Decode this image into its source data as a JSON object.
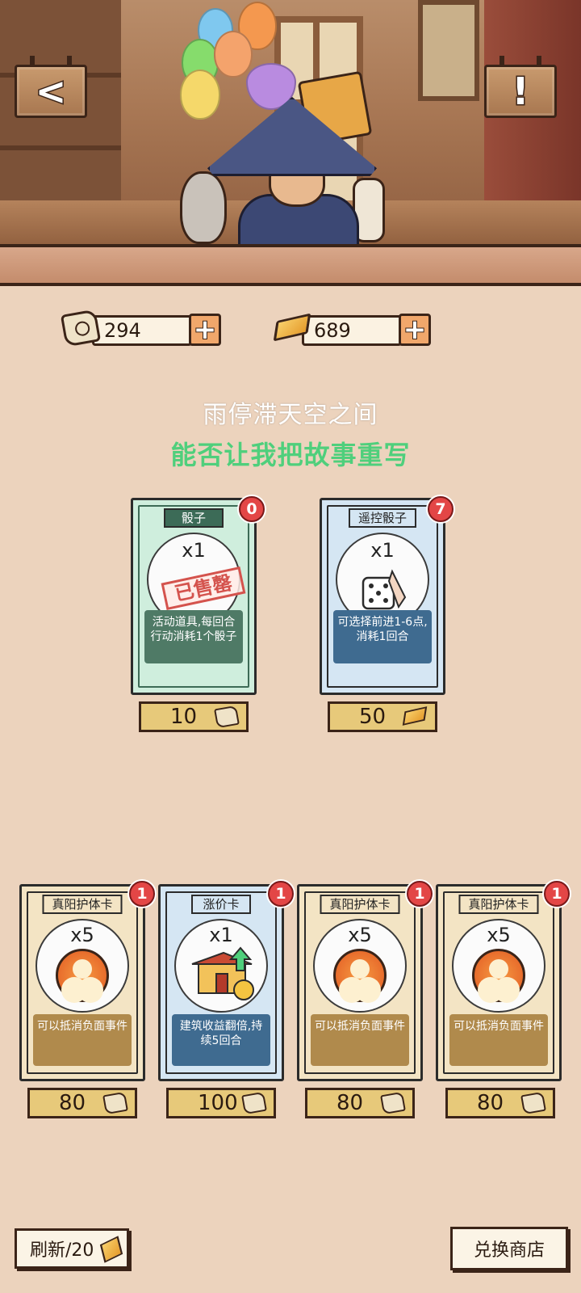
{
  "header": {
    "back_icon": "chevron-left-icon",
    "info_icon": "exclamation-icon",
    "back_glyph": "<",
    "info_glyph": "!"
  },
  "currency": {
    "scroll_amount": "294",
    "gold_amount": "689",
    "plus_glyph": "+"
  },
  "lyrics": {
    "line1": "雨停滞天空之间",
    "line2": "能否让我把故事重写"
  },
  "top_cards": [
    {
      "title": "骰子",
      "qty": "x1",
      "desc": "活动道具,每回合行动消耗1个骰子",
      "badge": "0",
      "price": "10",
      "currency": "scroll",
      "sold_out": "已售罄"
    },
    {
      "title": "遥控骰子",
      "qty": "x1",
      "desc": "可选择前进1-6点,消耗1回合",
      "badge": "7",
      "price": "50",
      "currency": "gold"
    }
  ],
  "bottom_cards": [
    {
      "title": "真阳护体卡",
      "qty": "x5",
      "desc": "可以抵消负面事件",
      "badge": "1",
      "price": "80"
    },
    {
      "title": "涨价卡",
      "qty": "x1",
      "desc": "建筑收益翻倍,持续5回合",
      "badge": "1",
      "price": "100"
    },
    {
      "title": "真阳护体卡",
      "qty": "x5",
      "desc": "可以抵消负面事件",
      "badge": "1",
      "price": "80"
    },
    {
      "title": "真阳护体卡",
      "qty": "x5",
      "desc": "可以抵消负面事件",
      "badge": "1",
      "price": "80"
    }
  ],
  "footer": {
    "refresh_label": "刷新/20",
    "exchange_label": "兑换商店"
  },
  "colors": {
    "background": "#ecd3bd",
    "lyric_highlight": "#4fcf7c",
    "badge_red": "#e34646",
    "desc_green": "#4f7a66",
    "desc_blue": "#3f6b90",
    "desc_gold": "#b08a4c"
  }
}
